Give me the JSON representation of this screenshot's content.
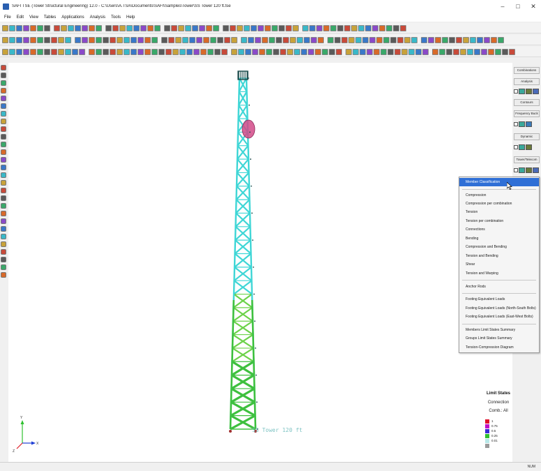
{
  "window": {
    "title": "SAFI TSE (Tower Structural Engineering) 12.0 - C:\\Users\\A.TSA\\Documents\\SAFI\\Samples\\Tower\\SS Tower 120 ft.tse",
    "minimize": "–",
    "maximize": "□",
    "close": "✕"
  },
  "menubar": {
    "items": [
      "File",
      "Edit",
      "View",
      "Tables",
      "Applications",
      "Analysis",
      "Tools",
      "Help"
    ]
  },
  "right_panel": {
    "sections": [
      "Combinations",
      "Analysis",
      "Contours",
      "Frequency Buck",
      "Dynamic",
      "Tower/Telecom"
    ]
  },
  "context_menu": {
    "groups": [
      [
        "Member Classification"
      ],
      [
        "Compression",
        "Compression per combination",
        "Tension",
        "Tension per combination",
        "Connections",
        "Bending",
        "Compression and Bending",
        "Tension and Bending",
        "Shear",
        "Tension and Warping"
      ],
      [
        "Anchor Rods"
      ],
      [
        "Footing Equivalent Loads",
        "Footing Equivalent Loads (North-South Bolts)",
        "Footing Equivalent Loads (East-West Bolts)"
      ],
      [
        "Members Limit States Summary",
        "Groups Limit States Summary",
        "Tension-Compression Diagram"
      ]
    ],
    "active_item": "Member Classification"
  },
  "legend": {
    "title": "Limit States",
    "subtitle": "Connection",
    "combo": "Comb.: All",
    "entries": [
      {
        "label": "1",
        "color": "#e0102a"
      },
      {
        "label": "0.75",
        "color": "#c010c8"
      },
      {
        "label": "0.5",
        "color": "#3a2ad8"
      },
      {
        "label": "0.25",
        "color": "#30c030"
      },
      {
        "label": "0.01",
        "color": "#b8e8e8"
      }
    ]
  },
  "canvas": {
    "tower_label": "SS Tower 120 ft",
    "member_colors": {
      "low": "#3fd6d6",
      "mid": "#6cd24a",
      "high": "#3ec03e",
      "edge": "#1a4a4a",
      "antenna": "#d24a88"
    }
  },
  "statusbar": {
    "mode": "NUM"
  }
}
